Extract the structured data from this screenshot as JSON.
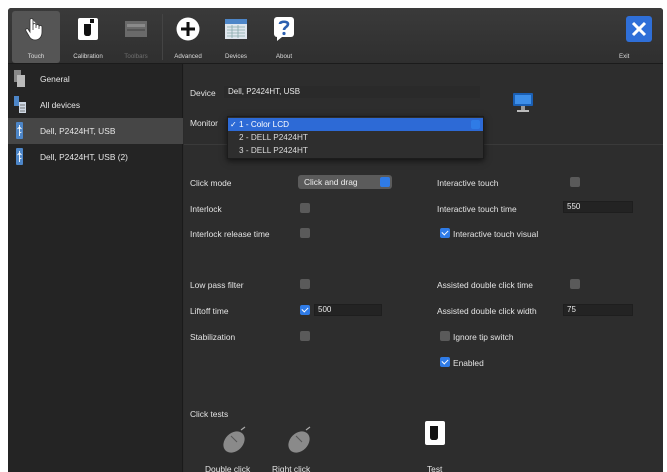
{
  "toolbar": {
    "buttons": [
      {
        "label": "Touch",
        "icon": "hand-pointer-icon",
        "active": true
      },
      {
        "label": "Calibration",
        "icon": "calibration-target-icon"
      },
      {
        "label": "Toolbars",
        "icon": "toolbars-icon",
        "disabled": true
      },
      {
        "label": "Advanced",
        "icon": "plus-circle-icon"
      },
      {
        "label": "Devices",
        "icon": "devices-grid-icon"
      },
      {
        "label": "About",
        "icon": "question-icon"
      }
    ],
    "exit_label": "Exit",
    "exit_icon": "close-icon"
  },
  "sidebar": {
    "items": [
      {
        "label": "General",
        "icon": "general-settings-icon"
      },
      {
        "label": "All devices",
        "icon": "all-devices-icon"
      },
      {
        "label": "Dell, P2424HT, USB",
        "icon": "usb-icon",
        "selected": true
      },
      {
        "label": "Dell, P2424HT, USB (2)",
        "icon": "usb-icon"
      }
    ]
  },
  "device": {
    "label": "Device",
    "value": "Dell, P2424HT, USB",
    "monitor_icon": "monitor-icon"
  },
  "monitor": {
    "label": "Monitor",
    "options": [
      "1 - Color LCD",
      "2 - DELL P2424HT",
      "3 - DELL P2424HT"
    ],
    "selected_index": 0
  },
  "settings": {
    "click_mode_label": "Click mode",
    "click_mode_value": "Click and drag",
    "interlock_label": "Interlock",
    "interlock_release_label": "Interlock release time",
    "low_pass_label": "Low pass filter",
    "liftoff_label": "Liftoff time",
    "liftoff_value": "500",
    "stabilization_label": "Stabilization",
    "interactive_touch_label": "Interactive touch",
    "interactive_touch_time_label": "Interactive touch time",
    "interactive_touch_time_value": "550",
    "interactive_touch_visual_label": "Interactive touch visual",
    "assisted_double_click_time_label": "Assisted double click time",
    "assisted_double_click_width_label": "Assisted double click width",
    "assisted_double_click_width_value": "75",
    "ignore_tip_switch_label": "Ignore tip switch",
    "enabled_label": "Enabled"
  },
  "click_tests": {
    "title": "Click tests",
    "double_click_label": "Double click",
    "right_click_label": "Right click",
    "test_label": "Test"
  },
  "colors": {
    "accent": "#2f7be6",
    "window_bg": "#2b2b2b",
    "exit_bg": "#2f6fd8"
  }
}
